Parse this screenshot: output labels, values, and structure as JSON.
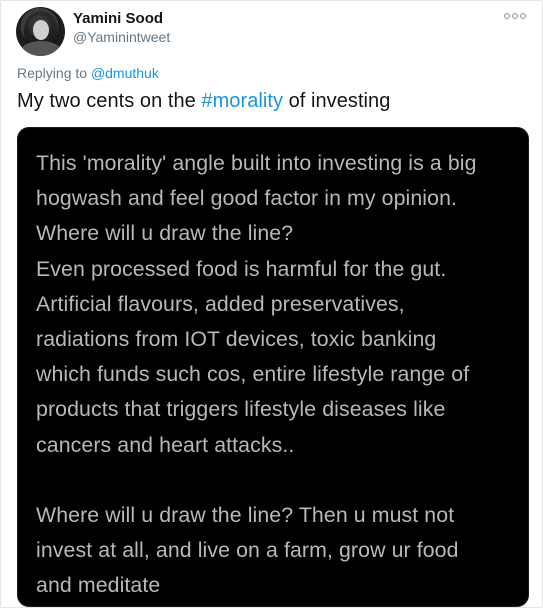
{
  "author": {
    "name": "Yamini Sood",
    "handle": "@Yaminintweet"
  },
  "reply": {
    "prefix": "Replying to",
    "mention": "@dmuthuk"
  },
  "tweet": {
    "text_before": "My two cents on the ",
    "hashtag": "#morality",
    "text_after": " of investing"
  },
  "image_text": {
    "lines": [
      "This 'morality' angle built into investing is a big",
      "hogwash and feel good factor in my opinion.",
      "Where will u draw the line?",
      "Even processed food is harmful for the gut.",
      "Artificial flavours, added preservatives,",
      "radiations from IOT devices, toxic banking",
      "which funds such cos, entire lifestyle range of",
      "products that triggers lifestyle diseases like",
      "cancers and heart attacks..",
      "",
      "Where will u draw the line? Then u must not",
      "invest at all, and live on a farm, grow ur food",
      "and meditate"
    ]
  },
  "icons": {
    "more": "more-options-icon",
    "avatar": "profile-avatar"
  },
  "colors": {
    "link": "#1b95e0",
    "muted": "#657786",
    "image_bg": "#000000",
    "image_text": "#b8b8b8"
  }
}
